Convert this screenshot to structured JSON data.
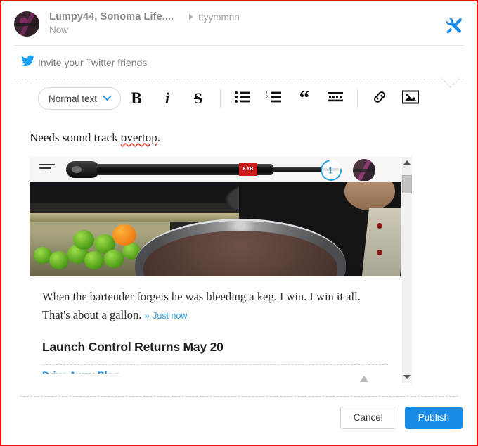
{
  "header": {
    "account_name": "Lumpy44, Sonoma Life....",
    "audience_tag": "ttyymmnn",
    "timestamp": "Now",
    "tools_icon": "tools-hammer-wrench-icon",
    "avatar_icon": "user-avatar"
  },
  "invite": {
    "label": "Invite your Twitter friends",
    "icon": "twitter-bird-icon"
  },
  "toolbar": {
    "style_select": {
      "value": "Normal text",
      "chevron_icon": "chevron-down-icon"
    },
    "buttons": [
      {
        "name": "bold-button",
        "glyph": "B",
        "icon": "bold-icon"
      },
      {
        "name": "italic-button",
        "glyph": "i",
        "icon": "italic-icon"
      },
      {
        "name": "strikethrough-button",
        "glyph": "S",
        "icon": "strikethrough-icon"
      },
      {
        "name": "bulleted-list-button",
        "glyph": "",
        "icon": "bulleted-list-icon"
      },
      {
        "name": "numbered-list-button",
        "glyph": "",
        "icon": "numbered-list-icon"
      },
      {
        "name": "blockquote-button",
        "glyph": "“",
        "icon": "quote-icon"
      },
      {
        "name": "more-formats-button",
        "glyph": "",
        "icon": "horizontal-rule-icon"
      },
      {
        "name": "link-button",
        "glyph": "",
        "icon": "link-icon"
      },
      {
        "name": "image-button",
        "glyph": "",
        "icon": "image-icon"
      }
    ]
  },
  "document": {
    "paragraph_before": "Needs sound track ",
    "misspelled_word": "overtop",
    "paragraph_after": "."
  },
  "embed": {
    "thumbnail_alt": "black-shock-absorber-product-photo",
    "menu_icon": "hamburger-menu-icon",
    "count_badge": "1",
    "avatar_icon": "embed-user-avatar",
    "photo_alt": "bartender-holding-large-metal-bowl-with-limes-and-orange",
    "caption": "When the bartender forgets he was bleeding a keg. I win. I win it all. That's",
    "caption_line2": "about a gallon.",
    "caption_chevron": "»",
    "caption_time": "Just now",
    "heading": "Launch Control Returns May 20",
    "link_text": "Drive Away Blog",
    "scrollbar": {
      "up_icon": "scroll-up-arrow-icon",
      "down_icon": "scroll-down-arrow-icon",
      "thumb": "scrollbar-thumb"
    }
  },
  "footer": {
    "cancel_label": "Cancel",
    "publish_label": "Publish"
  },
  "colors": {
    "accent_blue": "#1a8ce8",
    "link_blue": "#2a9fe0",
    "twitter_blue": "#1da1f2",
    "frame_red": "#ee1111",
    "spellcheck_red": "#e03a2f"
  }
}
